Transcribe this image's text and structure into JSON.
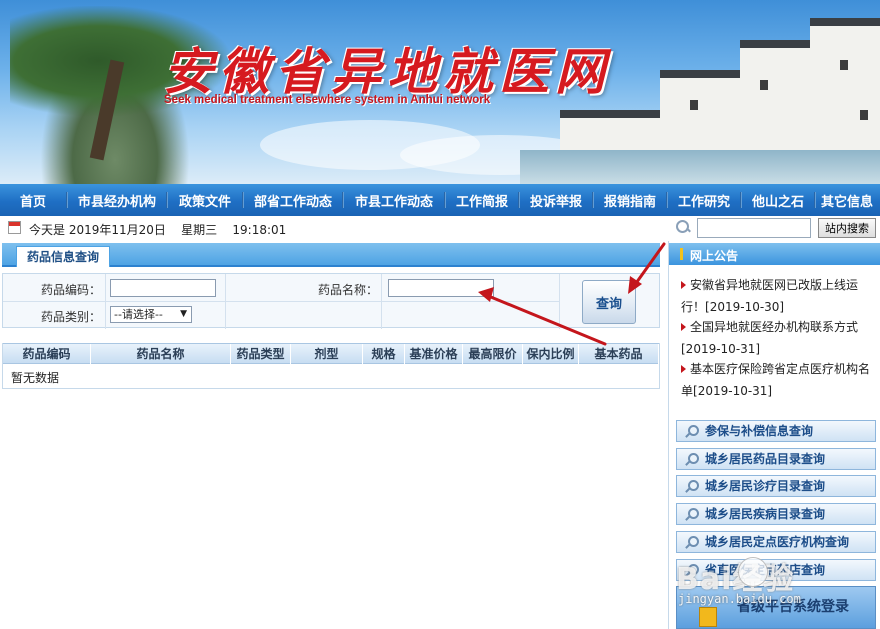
{
  "header": {
    "title_cn": "安徽省异地就医网",
    "title_en": "Seek medical treatment elsewhere system in Anhui network"
  },
  "nav": {
    "items": [
      "首页",
      "市县经办机构",
      "政策文件",
      "部省工作动态",
      "市县工作动态",
      "工作简报",
      "投诉举报",
      "报销指南",
      "工作研究",
      "他山之石",
      "其它信息"
    ]
  },
  "datebar": {
    "date_text": "今天是 2019年11月20日    星期三    19:18:01",
    "search_button": "站内搜索",
    "search_value": ""
  },
  "panel": {
    "tab_label": "药品信息查询"
  },
  "form": {
    "code_label": "药品编码：",
    "code_value": "",
    "name_label": "药品名称：",
    "name_value": "",
    "category_label": "药品类别：",
    "category_selected": "--请选择--",
    "query_button": "查询"
  },
  "table": {
    "columns": [
      "药品编码",
      "药品名称",
      "药品类型",
      "剂型",
      "规格",
      "基准价格",
      "最高限价",
      "保内比例",
      "基本药品"
    ],
    "empty_text": "暂无数据"
  },
  "sidebar": {
    "notice_title": "网上公告",
    "notices": [
      {
        "text": "安徽省异地就医网已改版上线运行！",
        "date": "[2019-10-30]"
      },
      {
        "text": "全国异地就医经办机构联系方式",
        "date": "[2019-10-31]"
      },
      {
        "text": "基本医疗保险跨省定点医疗机构名单",
        "date": "[2019-10-31]"
      }
    ],
    "query_buttons": [
      "参保与补偿信息查询",
      "城乡居民药品目录查询",
      "城乡居民诊疗目录查询",
      "城乡居民疾病目录查询",
      "城乡居民定点医疗机构查询",
      "省直医保定点药店查询"
    ],
    "login_button": "省级平台系统登录"
  },
  "watermark": {
    "logo": "Bai经验",
    "url": "jingyan.baidu.com"
  },
  "colors": {
    "nav_blue": "#1f6fc4",
    "title_red": "#d61a1f",
    "annotation_arrow": "#c4161c"
  }
}
